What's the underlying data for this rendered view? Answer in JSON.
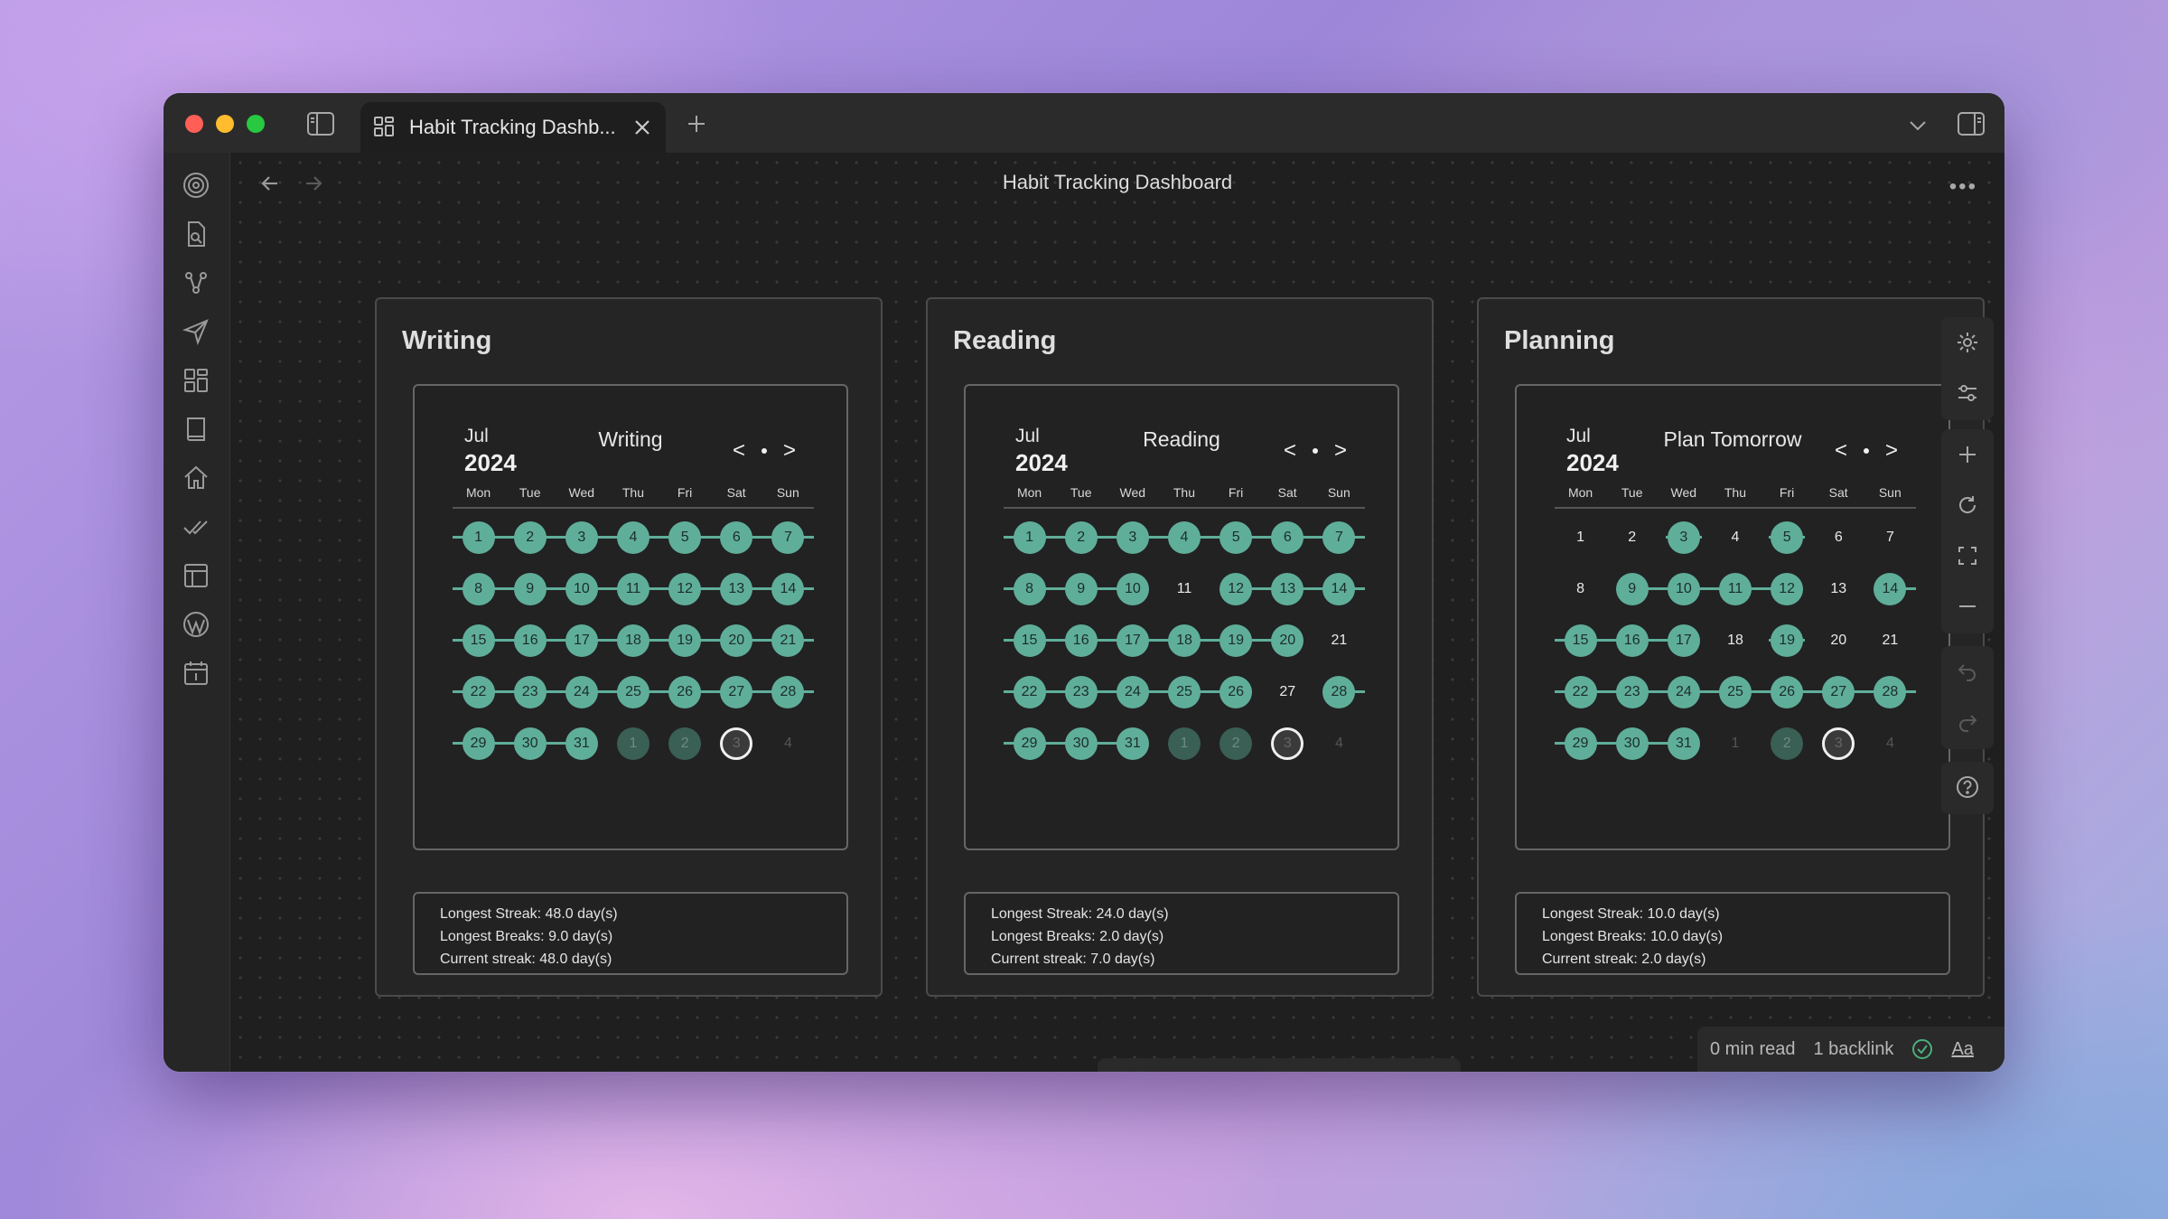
{
  "tab": {
    "title": "Habit Tracking Dashb..."
  },
  "page": {
    "title": "Habit Tracking Dashboard"
  },
  "weekdays": [
    "Mon",
    "Tue",
    "Wed",
    "Thu",
    "Fri",
    "Sat",
    "Sun"
  ],
  "habits": [
    {
      "card_title": "Writing",
      "month": "Jul",
      "year": "2024",
      "habit_name": "Writing",
      "weeks": [
        [
          {
            "d": "1",
            "s": "done"
          },
          {
            "d": "2",
            "s": "done"
          },
          {
            "d": "3",
            "s": "done"
          },
          {
            "d": "4",
            "s": "done"
          },
          {
            "d": "5",
            "s": "done"
          },
          {
            "d": "6",
            "s": "done"
          },
          {
            "d": "7",
            "s": "done"
          }
        ],
        [
          {
            "d": "8",
            "s": "done"
          },
          {
            "d": "9",
            "s": "done"
          },
          {
            "d": "10",
            "s": "done"
          },
          {
            "d": "11",
            "s": "done"
          },
          {
            "d": "12",
            "s": "done"
          },
          {
            "d": "13",
            "s": "done"
          },
          {
            "d": "14",
            "s": "done"
          }
        ],
        [
          {
            "d": "15",
            "s": "done"
          },
          {
            "d": "16",
            "s": "done"
          },
          {
            "d": "17",
            "s": "done"
          },
          {
            "d": "18",
            "s": "done"
          },
          {
            "d": "19",
            "s": "done"
          },
          {
            "d": "20",
            "s": "done"
          },
          {
            "d": "21",
            "s": "done"
          }
        ],
        [
          {
            "d": "22",
            "s": "done"
          },
          {
            "d": "23",
            "s": "done"
          },
          {
            "d": "24",
            "s": "done"
          },
          {
            "d": "25",
            "s": "done"
          },
          {
            "d": "26",
            "s": "done"
          },
          {
            "d": "27",
            "s": "done"
          },
          {
            "d": "28",
            "s": "done"
          }
        ],
        [
          {
            "d": "29",
            "s": "done"
          },
          {
            "d": "30",
            "s": "done"
          },
          {
            "d": "31",
            "s": "done"
          },
          {
            "d": "1",
            "s": "future-done"
          },
          {
            "d": "2",
            "s": "future-done"
          },
          {
            "d": "3",
            "s": "today"
          },
          {
            "d": "4",
            "s": "future"
          }
        ]
      ],
      "stats": [
        "Longest Streak: 48.0 day(s)",
        "Longest Breaks: 9.0 day(s)",
        "Current streak: 48.0 day(s)"
      ]
    },
    {
      "card_title": "Reading",
      "month": "Jul",
      "year": "2024",
      "habit_name": "Reading",
      "weeks": [
        [
          {
            "d": "1",
            "s": "done"
          },
          {
            "d": "2",
            "s": "done"
          },
          {
            "d": "3",
            "s": "done"
          },
          {
            "d": "4",
            "s": "done"
          },
          {
            "d": "5",
            "s": "done"
          },
          {
            "d": "6",
            "s": "done"
          },
          {
            "d": "7",
            "s": "done"
          }
        ],
        [
          {
            "d": "8",
            "s": "done"
          },
          {
            "d": "9",
            "s": "done"
          },
          {
            "d": "10",
            "s": "done"
          },
          {
            "d": "11",
            "s": "miss"
          },
          {
            "d": "12",
            "s": "done"
          },
          {
            "d": "13",
            "s": "done"
          },
          {
            "d": "14",
            "s": "done"
          }
        ],
        [
          {
            "d": "15",
            "s": "done"
          },
          {
            "d": "16",
            "s": "done"
          },
          {
            "d": "17",
            "s": "done"
          },
          {
            "d": "18",
            "s": "done"
          },
          {
            "d": "19",
            "s": "done"
          },
          {
            "d": "20",
            "s": "done"
          },
          {
            "d": "21",
            "s": "miss"
          }
        ],
        [
          {
            "d": "22",
            "s": "done"
          },
          {
            "d": "23",
            "s": "done"
          },
          {
            "d": "24",
            "s": "done"
          },
          {
            "d": "25",
            "s": "done"
          },
          {
            "d": "26",
            "s": "done"
          },
          {
            "d": "27",
            "s": "miss"
          },
          {
            "d": "28",
            "s": "done"
          }
        ],
        [
          {
            "d": "29",
            "s": "done"
          },
          {
            "d": "30",
            "s": "done"
          },
          {
            "d": "31",
            "s": "done"
          },
          {
            "d": "1",
            "s": "future-done"
          },
          {
            "d": "2",
            "s": "future-done"
          },
          {
            "d": "3",
            "s": "today"
          },
          {
            "d": "4",
            "s": "future"
          }
        ]
      ],
      "stats": [
        "Longest Streak: 24.0 day(s)",
        "Longest Breaks: 2.0 day(s)",
        "Current streak: 7.0 day(s)"
      ]
    },
    {
      "card_title": "Planning",
      "month": "Jul",
      "year": "2024",
      "habit_name": "Plan Tomorrow",
      "weeks": [
        [
          {
            "d": "1",
            "s": "miss"
          },
          {
            "d": "2",
            "s": "miss"
          },
          {
            "d": "3",
            "s": "done"
          },
          {
            "d": "4",
            "s": "miss"
          },
          {
            "d": "5",
            "s": "done"
          },
          {
            "d": "6",
            "s": "miss"
          },
          {
            "d": "7",
            "s": "miss"
          }
        ],
        [
          {
            "d": "8",
            "s": "miss"
          },
          {
            "d": "9",
            "s": "done"
          },
          {
            "d": "10",
            "s": "done"
          },
          {
            "d": "11",
            "s": "done"
          },
          {
            "d": "12",
            "s": "done"
          },
          {
            "d": "13",
            "s": "miss"
          },
          {
            "d": "14",
            "s": "done"
          }
        ],
        [
          {
            "d": "15",
            "s": "done"
          },
          {
            "d": "16",
            "s": "done"
          },
          {
            "d": "17",
            "s": "done"
          },
          {
            "d": "18",
            "s": "miss"
          },
          {
            "d": "19",
            "s": "done"
          },
          {
            "d": "20",
            "s": "miss"
          },
          {
            "d": "21",
            "s": "miss"
          }
        ],
        [
          {
            "d": "22",
            "s": "done"
          },
          {
            "d": "23",
            "s": "done"
          },
          {
            "d": "24",
            "s": "done"
          },
          {
            "d": "25",
            "s": "done"
          },
          {
            "d": "26",
            "s": "done"
          },
          {
            "d": "27",
            "s": "done"
          },
          {
            "d": "28",
            "s": "done"
          }
        ],
        [
          {
            "d": "29",
            "s": "done"
          },
          {
            "d": "30",
            "s": "done"
          },
          {
            "d": "31",
            "s": "done"
          },
          {
            "d": "1",
            "s": "future"
          },
          {
            "d": "2",
            "s": "future-done"
          },
          {
            "d": "3",
            "s": "today"
          },
          {
            "d": "4",
            "s": "future"
          }
        ]
      ],
      "stats": [
        "Longest Streak: 10.0 day(s)",
        "Longest Breaks: 10.0 day(s)",
        "Current streak: 2.0 day(s)"
      ]
    }
  ],
  "cal_nav": {
    "prev": "<",
    "next": ">"
  },
  "status": {
    "read_time": "0 min read",
    "backlinks": "1 backlink",
    "font": "Aa"
  },
  "colors": {
    "accent": "#5fae9a",
    "bg": "#1f1f1f"
  }
}
